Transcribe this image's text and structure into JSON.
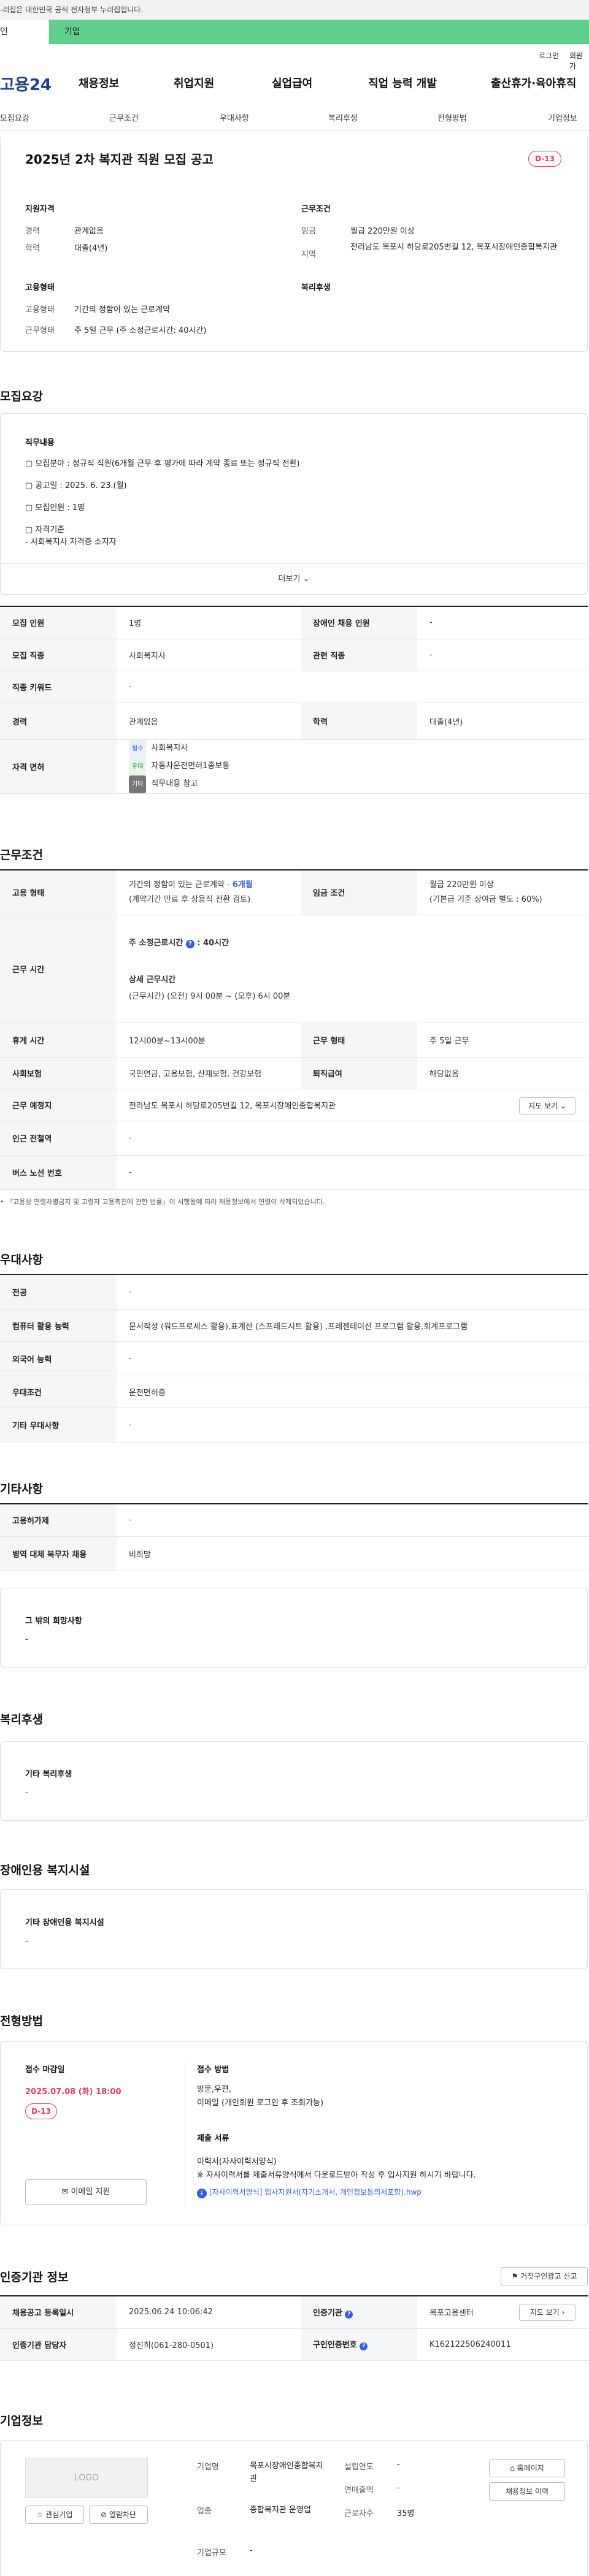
{
  "gov_banner": "-리집은 대한민국 공식 전자정부 누리집입니다.",
  "top_tabs": [
    "인",
    "기업"
  ],
  "util_links": [
    "로그인",
    "회원가"
  ],
  "header": {
    "logo": "고용24",
    "nav": [
      "채용정보",
      "취업지원",
      "실업급여",
      "직업 능력 개발",
      "출산휴가·육아휴직"
    ]
  },
  "subnav": [
    "모집요강",
    "근무조건",
    "우대사항",
    "복리후생",
    "전형방법",
    "기업정보"
  ],
  "job": {
    "title": "2025년 2차 복지관 직원 모집 공고",
    "dday": "D-13",
    "qual_head": "지원자격",
    "qual": [
      {
        "k": "경력",
        "v": "관계없음"
      },
      {
        "k": "학력",
        "v": "대졸(4년)"
      }
    ],
    "cond_head": "근무조건",
    "cond": [
      {
        "k": "임금",
        "v": "월급 220만원 이상"
      },
      {
        "k": "지역",
        "v": "전라남도 목포시 하당로205번길 12, 목포시장애인종합복지관"
      }
    ],
    "emp_head": "고용형태",
    "emp": [
      {
        "k": "고용형태",
        "v": "기간의 정함이 있는 근로계약"
      },
      {
        "k": "근무형태",
        "v": "주 5일 근무 (주 소정근로시간: 40시간)"
      }
    ],
    "welfare_head": "복리후생"
  },
  "recruit": {
    "title": "모집요강",
    "duty_head": "직무내용",
    "duty_lines": [
      "▢ 모집분야 : 정규직 직원(6개월 근무 후 평가에 따라 계약 종료 또는 정규직 전환)",
      "▢ 공고일 : 2025. 6. 23.(월)",
      "▢ 모집인원 : 1명",
      "▢ 자격기준",
      "- 사회복지사 자격증 소지자"
    ],
    "more": "더보기",
    "rows": {
      "r1": [
        "모집 인원",
        "1명",
        "장애인 채용 인원",
        "-"
      ],
      "r2": [
        "모집 직종",
        "사회복지사",
        "관련 직종",
        "-"
      ],
      "r3": [
        "직종 키워드",
        "-"
      ],
      "r4": [
        "경력",
        "관계없음",
        "학력",
        "대졸(4년)"
      ],
      "license_label": "자격 면허",
      "licenses": [
        {
          "tag": "필수",
          "name": "사회복지사"
        },
        {
          "tag": "우대",
          "name": "자동차운전면허1종보통"
        },
        {
          "tag": "기타",
          "name": "직무내용 참고"
        }
      ]
    }
  },
  "work": {
    "title": "근무조건",
    "emp_label": "고용 형태",
    "emp_v1": "기간의 정함이 있는 근로계약",
    "emp_v1b": "6개월",
    "emp_v2": "(계약기간 만료 후 상용직 전환 검토)",
    "wage_label": "임금 조건",
    "wage_v1": "월급 220만원 이상",
    "wage_v2": "(기본급 기준 상여금 별도 : 60%)",
    "hours_label": "근무 시간",
    "hours_h1": "주 소정근로시간",
    "hours_h1v": "40시간",
    "hours_h2": "상세 근무시간",
    "hours_v2": "(근무시간) (오전) 9시 00분 ~ (오후) 6시 00분",
    "rest": [
      "휴게 시간",
      "12시00분~13시00분",
      "근무 형태",
      "주 5일 근무"
    ],
    "ins": [
      "사회보험",
      "국민연금, 고용보험, 산재보험, 건강보험",
      "퇴직급여",
      "해당없음"
    ],
    "loc_label": "근무 예정지",
    "loc_value": "전라남도 목포시 하당로205번길 12, 목포시장애인종합복지관",
    "map_btn": "지도 보기",
    "subway": [
      "인근 전철역",
      "-"
    ],
    "bus": [
      "버스 노선 번호",
      "-"
    ],
    "footnote": "• 『고용상 연령차별금지 및 고령자 고용촉진에 관한 법률』이 시행됨에 따라 채용정보에서 연령이 삭제되었습니다."
  },
  "pref": {
    "title": "우대사항",
    "rows": [
      [
        "전공",
        "-"
      ],
      [
        "컴퓨터 활용 능력",
        "문서작성 (워드프로세스 활용),표계산 (스프레드시트 활용) ,프레젠테이션 프로그램 활용,회계프로그램"
      ],
      [
        "외국어 능력",
        "-"
      ],
      [
        "우대조건",
        "운전면허증"
      ],
      [
        "기타 우대사항",
        "-"
      ]
    ]
  },
  "etc": {
    "title": "기타사항",
    "rows": [
      [
        "고용허가제",
        "-"
      ],
      [
        "병역 대체 복무자 채용",
        "비희망"
      ]
    ],
    "other_head": "그 밖의 희망사항",
    "other_val": "-"
  },
  "benefit": {
    "title": "복리후생",
    "head": "기타 복리후생",
    "val": "-"
  },
  "facility": {
    "title": "장애인용 복지시설",
    "head": "기타 장애인용 복지시설",
    "val": "-"
  },
  "process": {
    "title": "전형방법",
    "deadline_head": "접수 마감일",
    "deadline": "2025.07.08 (화) 18:00",
    "dday": "D-13",
    "email_btn": "이메일 지원",
    "method_head": "접수 방법",
    "method_lines": [
      "방문,우편,",
      "이메일 (개인회원 로그인 후 조회가능)"
    ],
    "docs_head": "제출 서류",
    "docs_lines": [
      "이력서(자사이력서양식)",
      "※ 자사이력서를 제출서류양식에서 다운로드받아 작성 후 입사지원 하시기 바랍니다."
    ],
    "attach": "[자사이력서양식] 입사지원서(자기소개서, 개인정보동의서포함).hwp"
  },
  "certify": {
    "title": "인증기관 정보",
    "report_btn": "거짓구인광고 신고",
    "r1": [
      "채용공고 등록일시",
      "2025.06.24 10:06:42",
      "인증기관",
      "목포고용센터"
    ],
    "map_btn": "지도 보기",
    "r2": [
      "인증기관 담당자",
      "정진희(061-280-0501)",
      "구인인증번호",
      "K162122506240011"
    ]
  },
  "company": {
    "title": "기업정보",
    "logo": "LOGO",
    "interest_btn": "관심기업",
    "block_btn": "열람차단",
    "name_label": "기업명",
    "name": "목포시장애인종합복지관",
    "industry_label": "업종",
    "industry": "종합복지관 운영업",
    "size_label": "기업규모",
    "size": "-",
    "founded_label": "설립연도",
    "founded": "-",
    "sales_label": "연매출액",
    "sales": "-",
    "emp_label": "근로자수",
    "emp": "35명",
    "homepage_btn": "홈페이지",
    "history_btn": "채용정보 이력"
  }
}
